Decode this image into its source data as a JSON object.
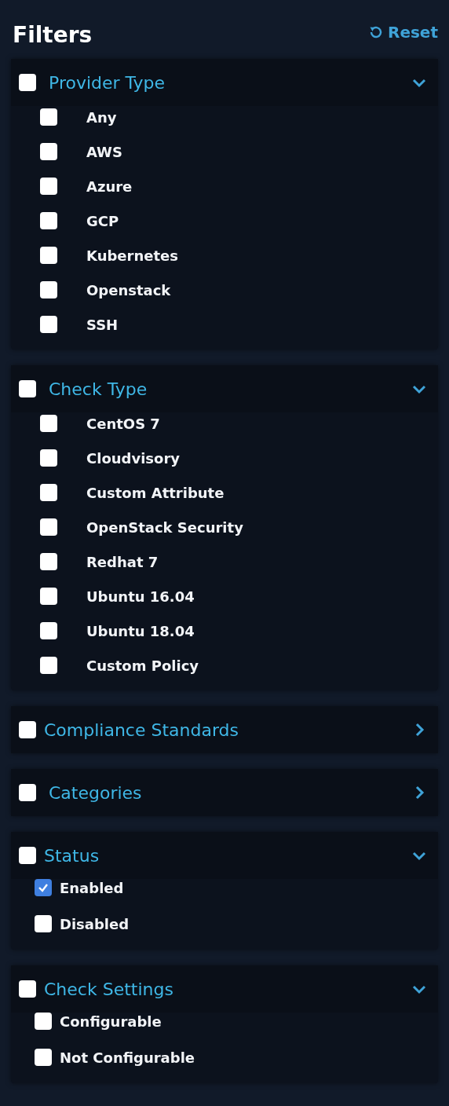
{
  "title": "Filters",
  "reset": {
    "label": "Reset"
  },
  "sections": [
    {
      "title": "Provider Type",
      "checked": false,
      "expanded": true,
      "kind": "wide",
      "options": [
        {
          "label": "Any",
          "checked": false
        },
        {
          "label": "AWS",
          "checked": false
        },
        {
          "label": "Azure",
          "checked": false
        },
        {
          "label": "GCP",
          "checked": false
        },
        {
          "label": "Kubernetes",
          "checked": false
        },
        {
          "label": "Openstack",
          "checked": false
        },
        {
          "label": "SSH",
          "checked": false
        }
      ]
    },
    {
      "title": "Check Type",
      "checked": false,
      "expanded": true,
      "kind": "wide",
      "options": [
        {
          "label": "CentOS 7",
          "checked": false
        },
        {
          "label": "Cloudvisory",
          "checked": false
        },
        {
          "label": "Custom Attribute",
          "checked": false
        },
        {
          "label": "OpenStack Security",
          "checked": false
        },
        {
          "label": "Redhat 7",
          "checked": false
        },
        {
          "label": "Ubuntu 16.04",
          "checked": false
        },
        {
          "label": "Ubuntu 18.04",
          "checked": false
        },
        {
          "label": "Custom Policy",
          "checked": false
        }
      ]
    },
    {
      "title": "Compliance Standards",
      "checked": false,
      "expanded": false,
      "kind": "compact"
    },
    {
      "title": "Categories",
      "checked": false,
      "expanded": false,
      "kind": "wide"
    },
    {
      "title": "Status",
      "checked": false,
      "expanded": true,
      "kind": "compact",
      "options": [
        {
          "label": "Enabled",
          "checked": true
        },
        {
          "label": "Disabled",
          "checked": false
        }
      ]
    },
    {
      "title": "Check Settings",
      "checked": false,
      "expanded": true,
      "kind": "compact",
      "options": [
        {
          "label": "Configurable",
          "checked": false
        },
        {
          "label": "Not Configurable",
          "checked": false
        }
      ]
    }
  ]
}
